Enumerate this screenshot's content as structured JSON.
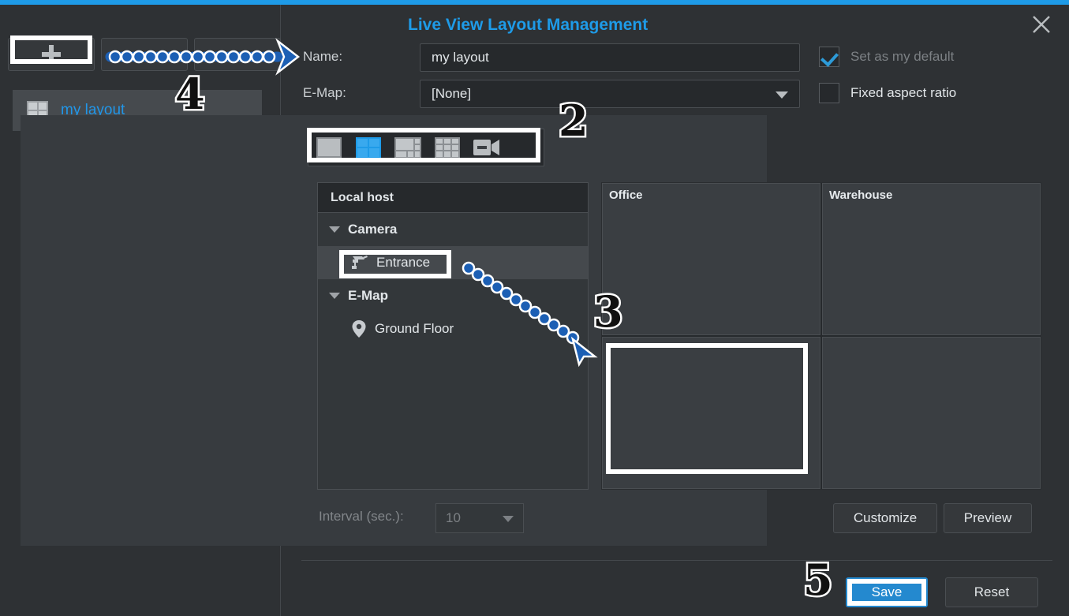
{
  "window": {
    "title": "Live View Layout Management",
    "close_icon": "close-icon",
    "accent_color": "#1e9be8"
  },
  "sidebar": {
    "toolbar": [
      {
        "name": "add-layout-button",
        "icon": "plus-icon",
        "label": "+"
      },
      {
        "name": "second-toolbar-button",
        "icon": "",
        "label": ""
      },
      {
        "name": "third-toolbar-button",
        "icon": "",
        "label": ""
      }
    ],
    "items": [
      {
        "label": "my layout",
        "icon": "grid-2x2-icon",
        "selected": true
      }
    ]
  },
  "form": {
    "name_label": "Name:",
    "name_value": "my layout",
    "emap_label": "E-Map:",
    "emap_value": "[None]",
    "set_default_label": "Set as my default",
    "set_default_checked": true,
    "set_default_disabled": true,
    "fixed_aspect_label": "Fixed aspect ratio",
    "fixed_aspect_checked": false
  },
  "mode_bar": {
    "modes": [
      {
        "name": "layout-1x1",
        "label": "1x1",
        "selected": false
      },
      {
        "name": "layout-2x2",
        "label": "2x2",
        "selected": true
      },
      {
        "name": "layout-1plus5",
        "label": "1+5",
        "selected": false
      },
      {
        "name": "layout-3x3",
        "label": "3x3",
        "selected": false
      },
      {
        "name": "layout-sequence",
        "label": "Sequence",
        "selected": false
      }
    ]
  },
  "tree": {
    "header": "Local host",
    "nodes": [
      {
        "label": "Camera",
        "type": "group",
        "expanded": true
      },
      {
        "label": "Entrance",
        "type": "camera",
        "selected": true
      },
      {
        "label": "E-Map",
        "type": "group",
        "expanded": true
      },
      {
        "label": "Ground Floor",
        "type": "emap"
      }
    ]
  },
  "preview_grid": {
    "cells": [
      {
        "label": "Office",
        "highlighted": false
      },
      {
        "label": "Warehouse",
        "highlighted": false
      },
      {
        "label": "",
        "highlighted": true
      },
      {
        "label": "",
        "highlighted": false
      }
    ]
  },
  "interval": {
    "label": "Interval (sec.):",
    "value": "10",
    "disabled": true
  },
  "buttons": {
    "customize": "Customize",
    "preview": "Preview",
    "save": "Save",
    "reset": "Reset"
  },
  "annotations": {
    "steps": [
      {
        "number": "2",
        "target": "layout-mode-bar"
      },
      {
        "number": "3",
        "target": "preview-cell-bottom-left"
      },
      {
        "number": "4",
        "target": "add-layout-button"
      },
      {
        "number": "5",
        "target": "save-button"
      }
    ]
  }
}
